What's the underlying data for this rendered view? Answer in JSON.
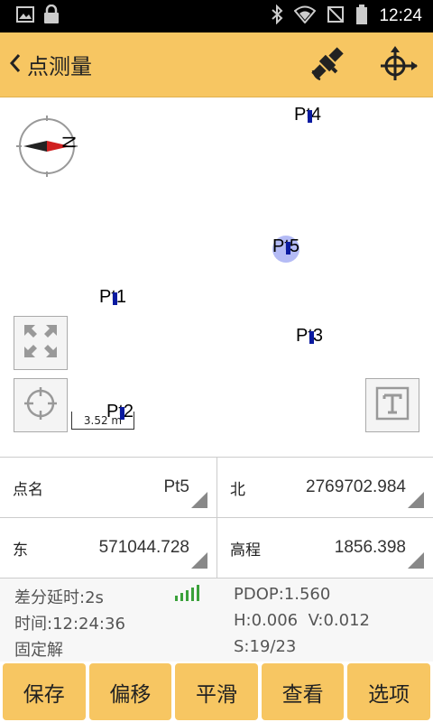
{
  "status_bar": {
    "time": "12:24",
    "icons": [
      "image-icon",
      "lock-icon",
      "bluetooth-icon",
      "wifi-icon",
      "no-sim-icon",
      "battery-icon"
    ]
  },
  "appbar": {
    "title": "点测量",
    "icons": [
      "back-chevron-icon",
      "satellite-icon",
      "gps-locate-icon"
    ]
  },
  "map": {
    "points": [
      {
        "name": "Pt4"
      },
      {
        "name": "Pt5"
      },
      {
        "name": "Pt1"
      },
      {
        "name": "Pt3"
      },
      {
        "name": "Pt2"
      }
    ],
    "compass_label": "N",
    "scale_label": "3.52 m",
    "highlight_point": "Pt5"
  },
  "info": {
    "point_name_label": "点名",
    "point_name_value": "Pt5",
    "north_label": "北",
    "north_value": "2769702.984",
    "east_label": "东",
    "east_value": "571044.728",
    "elevation_label": "高程",
    "elevation_value": "1856.398"
  },
  "status": {
    "diff_delay": "差分延时:2s",
    "time": "时间:12:24:36",
    "solution": "固定解",
    "pdop": "PDOP:1.560",
    "hv": "H:0.006  V:0.012",
    "sats": "S:19/23",
    "signal_bars": 5,
    "signal_color": "#3aa13a"
  },
  "buttons": {
    "save": "保存",
    "offset": "偏移",
    "smooth": "平滑",
    "view": "查看",
    "options": "选项"
  },
  "colors": {
    "accent": "#f7c662",
    "point_marker": "#0a1aa0",
    "highlight": "#8c96f0"
  }
}
